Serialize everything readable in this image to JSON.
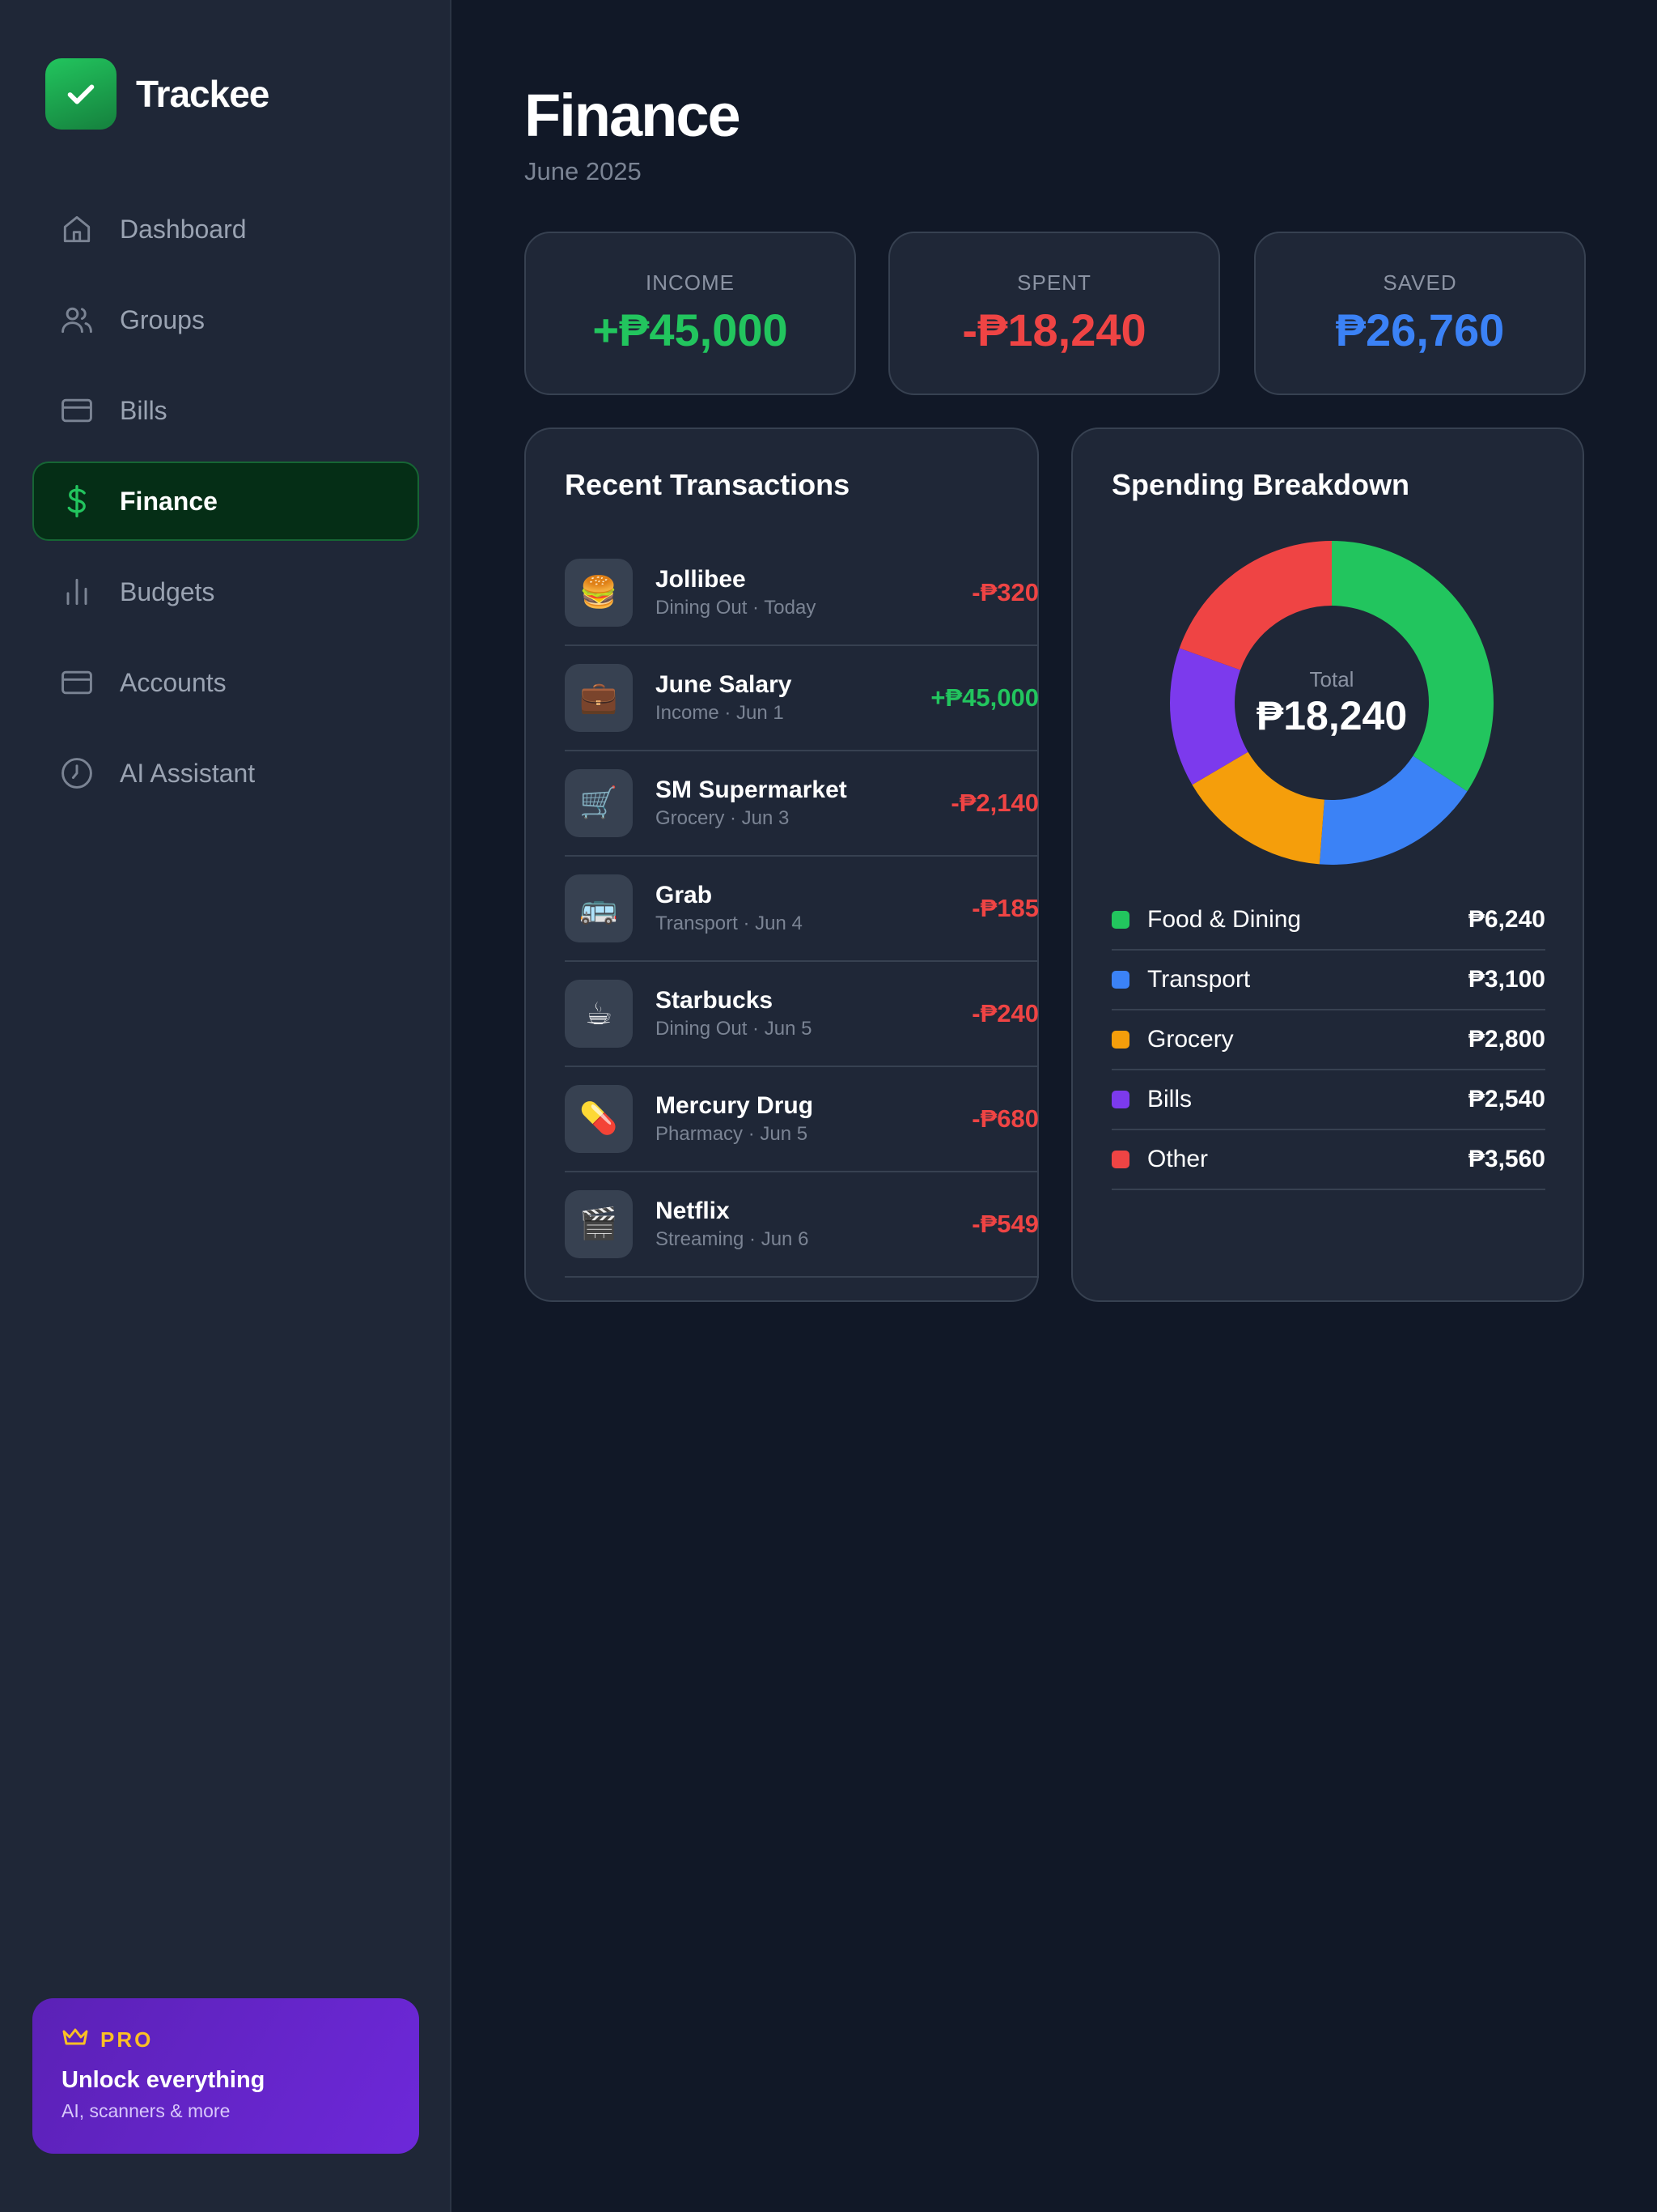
{
  "brand": {
    "name": "Trackee",
    "logo_icon": "check-icon"
  },
  "nav": {
    "items": [
      {
        "label": "Dashboard",
        "icon": "home-icon",
        "active": false
      },
      {
        "label": "Groups",
        "icon": "users-icon",
        "active": false
      },
      {
        "label": "Bills",
        "icon": "card-icon",
        "active": false
      },
      {
        "label": "Finance",
        "icon": "dollar-icon",
        "active": true
      },
      {
        "label": "Budgets",
        "icon": "bar-chart-icon",
        "active": false
      },
      {
        "label": "Accounts",
        "icon": "card-icon",
        "active": false
      },
      {
        "label": "AI Assistant",
        "icon": "clock-icon",
        "active": false
      }
    ]
  },
  "pro": {
    "tag": "PRO",
    "title": "Unlock everything",
    "subtitle": "AI, scanners & more",
    "icon": "crown-icon"
  },
  "page": {
    "title": "Finance",
    "subtitle": "June 2025"
  },
  "stats": {
    "income": {
      "label": "INCOME",
      "value": "+₱45,000",
      "color": "#22c55e"
    },
    "spent": {
      "label": "SPENT",
      "value": "-₱18,240",
      "color": "#ef4444"
    },
    "saved": {
      "label": "SAVED",
      "value": "₱26,760",
      "color": "#3b82f6"
    }
  },
  "transactions": {
    "title": "Recent Transactions",
    "items": [
      {
        "name": "Jollibee",
        "meta": "Dining Out · Today",
        "amount": "-₱320",
        "icon": "🍔",
        "positive": false
      },
      {
        "name": "June Salary",
        "meta": "Income · Jun 1",
        "amount": "+₱45,000",
        "icon": "💼",
        "positive": true
      },
      {
        "name": "SM Supermarket",
        "meta": "Grocery · Jun 3",
        "amount": "-₱2,140",
        "icon": "🛒",
        "positive": false
      },
      {
        "name": "Grab",
        "meta": "Transport · Jun 4",
        "amount": "-₱185",
        "icon": "🚌",
        "positive": false
      },
      {
        "name": "Starbucks",
        "meta": "Dining Out · Jun 5",
        "amount": "-₱240",
        "icon": "☕",
        "positive": false
      },
      {
        "name": "Mercury Drug",
        "meta": "Pharmacy · Jun 5",
        "amount": "-₱680",
        "icon": "💊",
        "positive": false
      },
      {
        "name": "Netflix",
        "meta": "Streaming · Jun 6",
        "amount": "-₱549",
        "icon": "🎬",
        "positive": false
      }
    ]
  },
  "breakdown": {
    "title": "Spending Breakdown",
    "center_label": "Total",
    "center_value": "₱18,240",
    "items": [
      {
        "label": "Food & Dining",
        "value": "₱6,240",
        "color": "#22c55e"
      },
      {
        "label": "Transport",
        "value": "₱3,100",
        "color": "#3b82f6"
      },
      {
        "label": "Grocery",
        "value": "₱2,800",
        "color": "#f59e0b"
      },
      {
        "label": "Bills",
        "value": "₱2,540",
        "color": "#7c3aed"
      },
      {
        "label": "Other",
        "value": "₱3,560",
        "color": "#ef4444"
      }
    ]
  },
  "chart_data": {
    "type": "pie",
    "categories": [
      "Food & Dining",
      "Transport",
      "Grocery",
      "Bills",
      "Other"
    ],
    "values": [
      6240,
      3100,
      2800,
      2540,
      3560
    ],
    "colors": [
      "#22c55e",
      "#3b82f6",
      "#f59e0b",
      "#7c3aed",
      "#ef4444"
    ],
    "title": "Spending Breakdown"
  }
}
